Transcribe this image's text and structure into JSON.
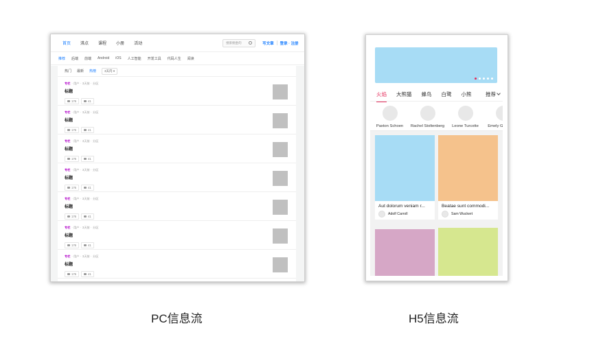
{
  "pc": {
    "nav": [
      "首页",
      "沸点",
      "课程",
      "小册",
      "活动"
    ],
    "search_placeholder": "搜索掘金的",
    "write_label": "写文章",
    "login_label": "登录 · 注册",
    "categories": [
      "推荐",
      "后端",
      "前端",
      "Android",
      "iOS",
      "人工智能",
      "开发工具",
      "代码人生",
      "阅读"
    ],
    "sort": [
      "热门",
      "最新",
      "热榜"
    ],
    "sort_range": "3天内",
    "items": [
      {
        "column": "专栏",
        "meta": [
          "· 用户 ·",
          "3天前 ·",
          "分区"
        ],
        "title": "标题",
        "likes": "176",
        "comments": "41"
      },
      {
        "column": "专栏",
        "meta": [
          "· 用户 ·",
          "3天前 ·",
          "分区"
        ],
        "title": "标题",
        "likes": "176",
        "comments": "41"
      },
      {
        "column": "专栏",
        "meta": [
          "· 用户 ·",
          "3天前 ·",
          "分区"
        ],
        "title": "标题",
        "likes": "176",
        "comments": "41"
      },
      {
        "column": "专栏",
        "meta": [
          "· 用户 ·",
          "3天前 ·",
          "分区"
        ],
        "title": "标题",
        "likes": "176",
        "comments": "41"
      },
      {
        "column": "专栏",
        "meta": [
          "· 用户 ·",
          "3天前 ·",
          "分区"
        ],
        "title": "标题",
        "likes": "176",
        "comments": "41"
      },
      {
        "column": "专栏",
        "meta": [
          "· 用户 ·",
          "3天前 ·",
          "分区"
        ],
        "title": "标题",
        "likes": "176",
        "comments": "41"
      },
      {
        "column": "专栏",
        "meta": [
          "· 用户 ·",
          "3天前 ·",
          "分区"
        ],
        "title": "标题",
        "likes": "176",
        "comments": "41"
      }
    ],
    "caption": "PC信息流"
  },
  "h5": {
    "banner_color": "#a7dcf5",
    "tabs": [
      "火焰",
      "大熊猫",
      "蜂鸟",
      "白鹭",
      "小熊"
    ],
    "more_label": "推荐",
    "users": [
      "Paxton Schoen",
      "Rachel Stoltenberg",
      "Leone Turcotte",
      "Emely Gulgowski"
    ],
    "cards": [
      {
        "caption": "Aut dolorum veniam r...",
        "author": "Adolf Carroll",
        "color": "#a7dcf5"
      },
      {
        "caption": "Beatae sunt commodi...",
        "author": "Sam Wuckert",
        "color": "#f5c28c"
      },
      {
        "caption": "",
        "author": "",
        "color": "#d6a7c6"
      },
      {
        "caption": "",
        "author": "",
        "color": "#d6e78f"
      }
    ],
    "caption": "H5信息流"
  }
}
